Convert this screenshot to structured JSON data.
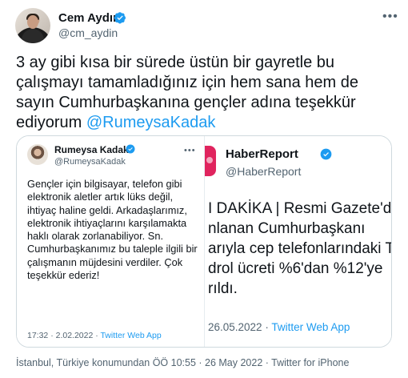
{
  "tweet": {
    "author_name": "Cem Aydın",
    "author_handle": "@cm_aydin",
    "text_before": "3 ay gibi kısa bir sürede üstün bir gayretle bu çalışmayı tamamladığınız için hem sana hem de sayın Cumhurbaşkanına gençler adına teşekkür ediyorum",
    "mention": "@RumeysaKadak",
    "more_icon": "more-horizontal-icon",
    "verified_icon": "verified-badge-icon",
    "accent_color": "#1d9bf0"
  },
  "quote_left": {
    "author_name": "Rumeysa Kadak",
    "author_handle": "@RumeysaKadak",
    "body": "Gençler için bilgisayar, telefon gibi elektronik aletler artık lüks değil, ihtiyaç haline geldi. Arkadaşlarımız, elektronik ihtiyaçlarını karşılamakta haklı olarak zorlanabiliyor. Sn. Cumhurbaşkanımız bu taleple ilgili bir çalışmanın müjdesini verdiler. Çok teşekkür ederiz!",
    "timestamp": "17:32 · 2.02.2022 · ",
    "source": "Twitter Web App"
  },
  "quote_right": {
    "author_name": "HaberReport",
    "author_handle": "@HaberReport",
    "lines": [
      "I DAKİKA | Resmi Gazete'd",
      "nlanan Cumhurbaşkanı",
      "arıyla cep telefonlarındaki T",
      "drol ücreti %6'dan %12'ye",
      "rıldı."
    ],
    "timestamp": "26.05.2022 · ",
    "source": "Twitter Web App"
  },
  "meta": {
    "text": "İstanbul, Türkiye konumundan ÖÖ 10:55 · 26 May 2022 · ",
    "client": "Twitter for iPhone"
  }
}
